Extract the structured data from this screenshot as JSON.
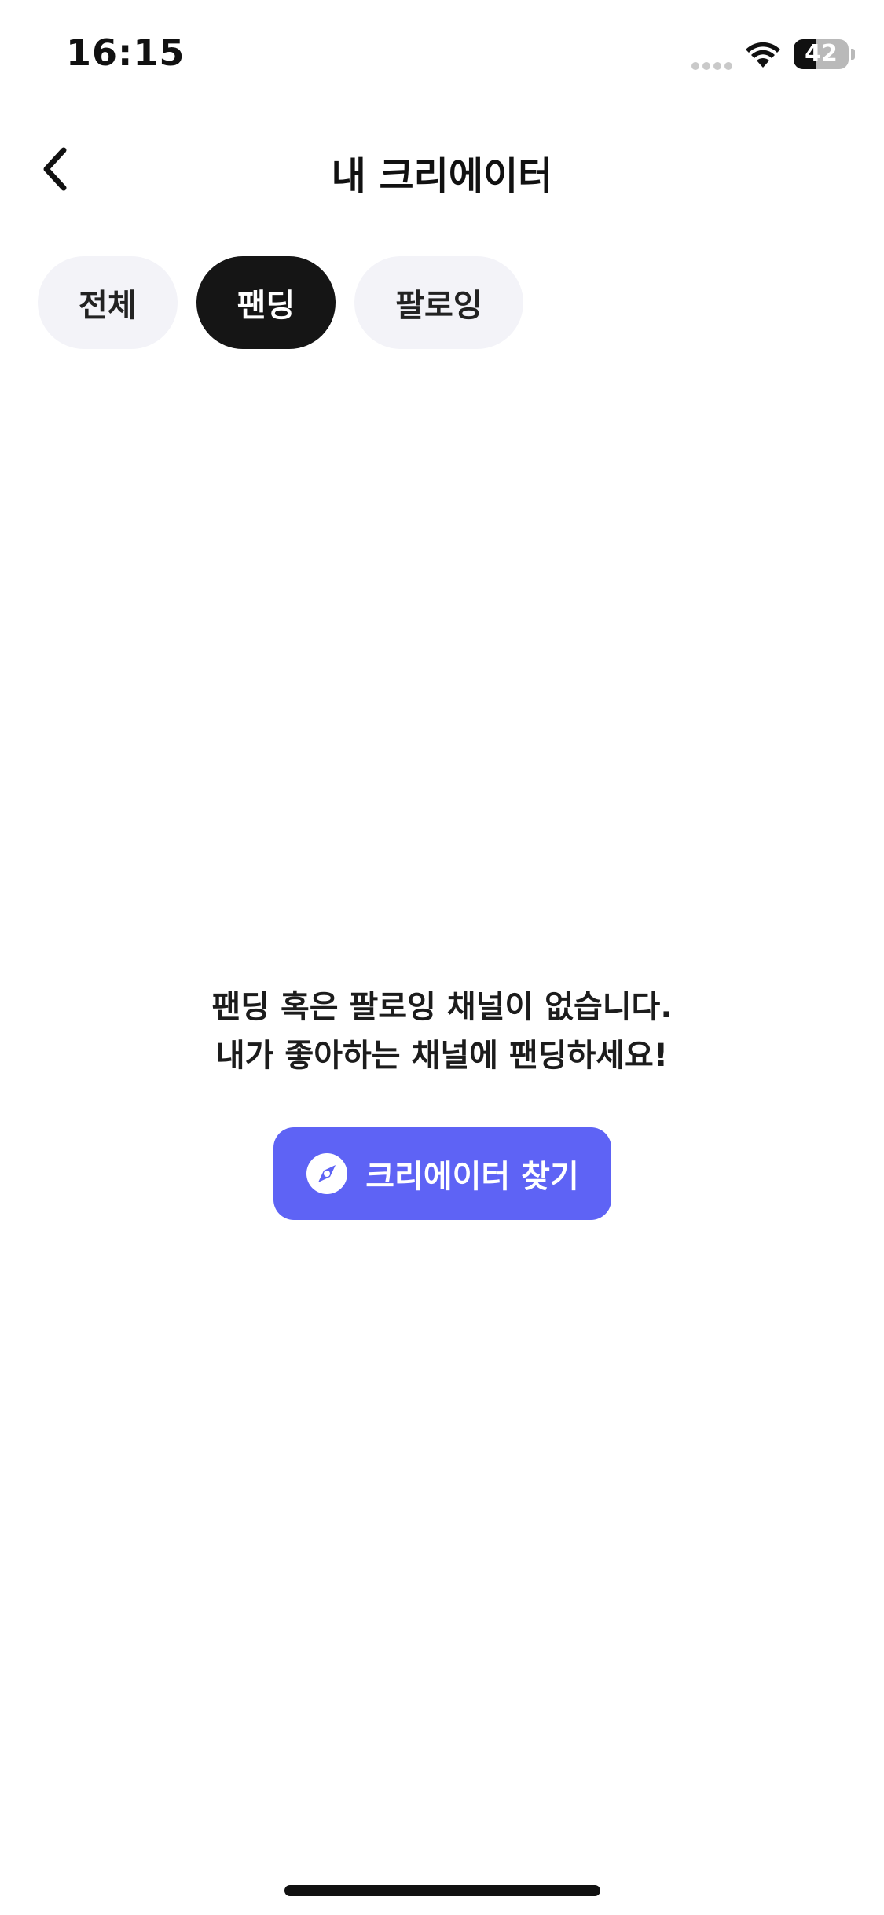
{
  "status_bar": {
    "time": "16:15",
    "battery_level": "42",
    "battery_fraction": 0.42
  },
  "header": {
    "title": "내 크리에이터",
    "back_icon": "chevron-left-icon"
  },
  "tabs": [
    {
      "label": "전체",
      "active": false
    },
    {
      "label": "팬딩",
      "active": true
    },
    {
      "label": "팔로잉",
      "active": false
    }
  ],
  "empty_state": {
    "line1": "팬딩 혹은 팔로잉 채널이 없습니다.",
    "line2": "내가 좋아하는 채널에 팬딩하세요!"
  },
  "find_button": {
    "label": "크리에이터 찾기",
    "icon": "compass-icon",
    "color": "#5e63f5"
  }
}
